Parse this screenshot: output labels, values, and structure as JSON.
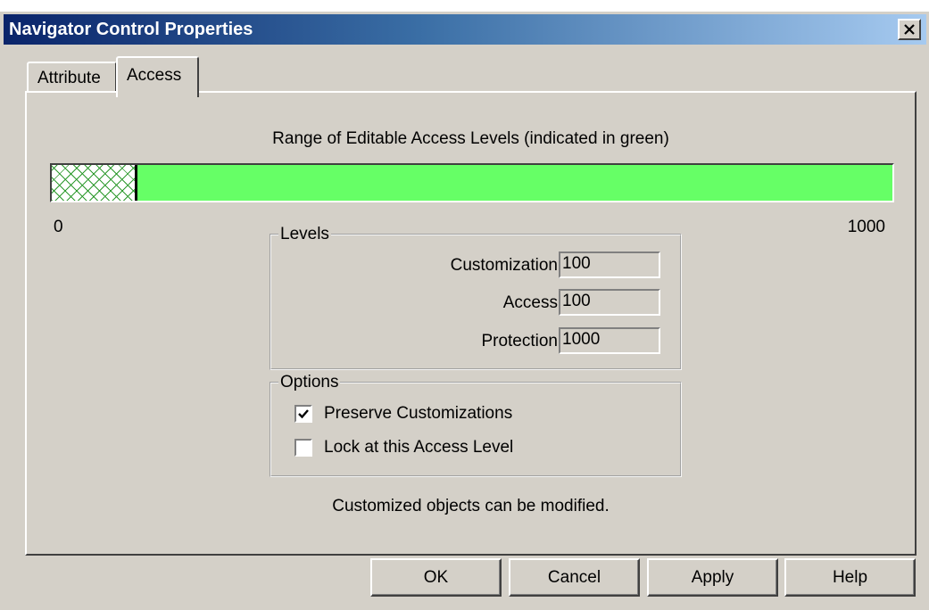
{
  "window": {
    "title": "Navigator Control Properties",
    "close_icon": "close-icon"
  },
  "tabs": [
    {
      "label": "Attribute",
      "selected": false
    },
    {
      "label": "Access",
      "selected": true
    }
  ],
  "access": {
    "range_caption": "Range of Editable Access Levels (indicated in green)",
    "range": {
      "min": 0,
      "max": 1000,
      "min_label": "0",
      "max_label": "1000",
      "editable_from": 100,
      "editable_to": 1000,
      "editable_color": "#66ff66",
      "locked_pattern_color": "#2e9a2e"
    },
    "levels": {
      "legend": "Levels",
      "customization_label": "Customization",
      "customization_value": "100",
      "access_label": "Access",
      "access_value": "100",
      "protection_label": "Protection",
      "protection_value": "1000"
    },
    "options": {
      "legend": "Options",
      "preserve_label": "Preserve Customizations",
      "preserve_checked": true,
      "lock_label": "Lock at this Access Level",
      "lock_checked": false
    },
    "status": "Customized objects can be modified."
  },
  "buttons": {
    "ok": "OK",
    "cancel": "Cancel",
    "apply": "Apply",
    "help": "Help"
  }
}
